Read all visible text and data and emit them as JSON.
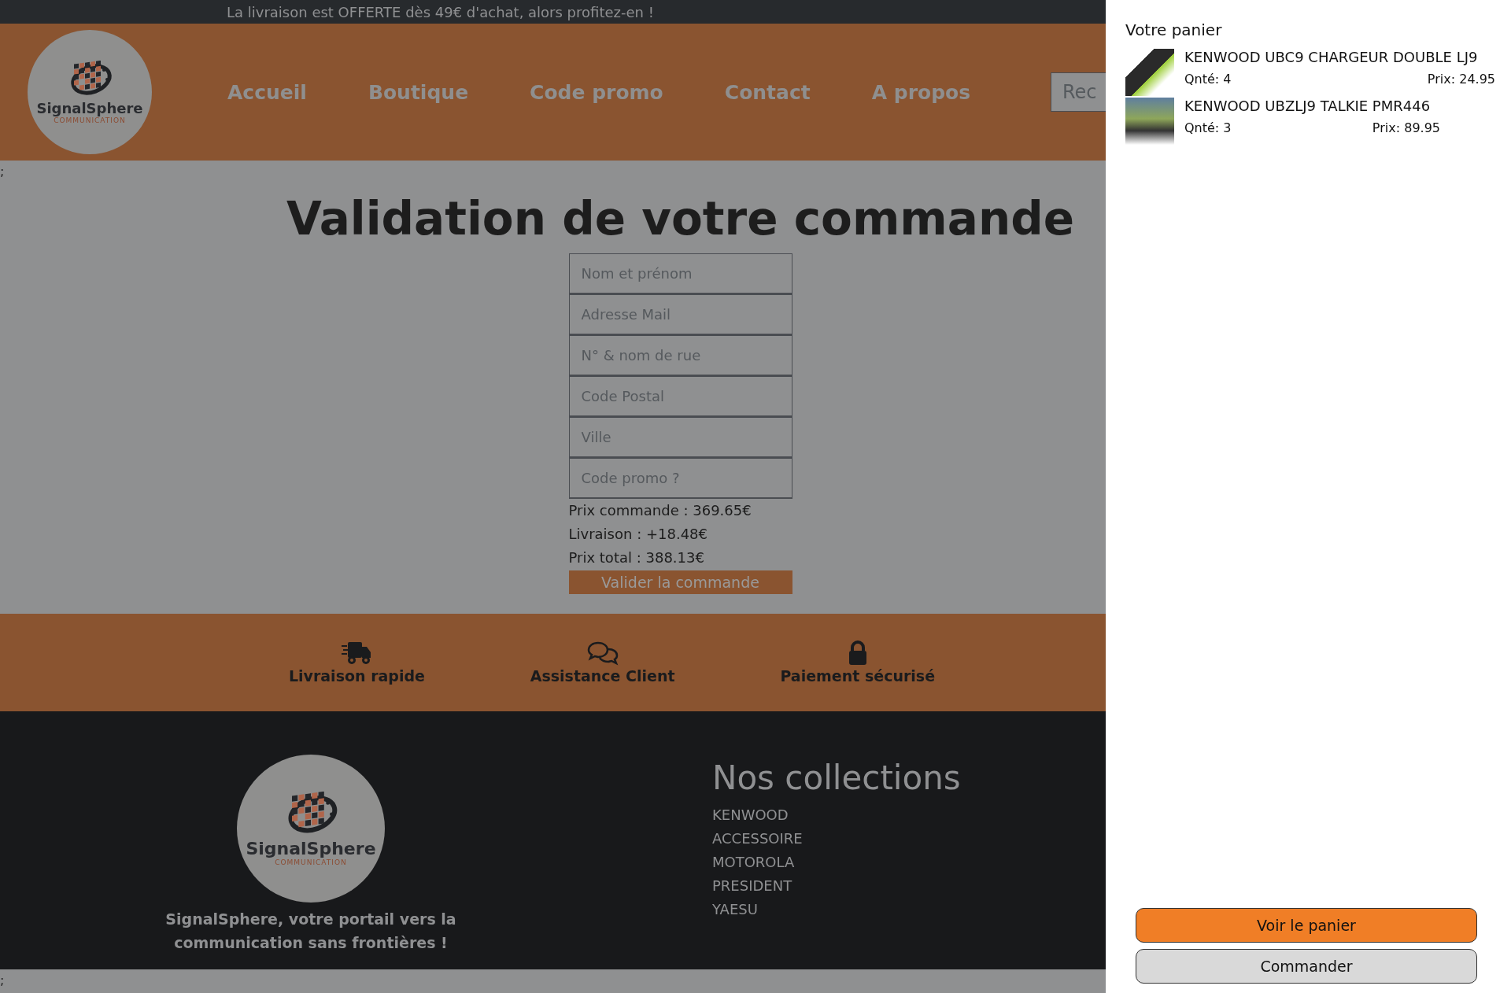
{
  "announcement": "La livraison est OFFERTE dès 49€ d'achat, alors profitez-en !",
  "header": {
    "logo": {
      "name": "SignalSphere",
      "tagline": "COMMUNICATION"
    },
    "nav": [
      {
        "label": "Accueil"
      },
      {
        "label": "Boutique"
      },
      {
        "label": "Code promo"
      },
      {
        "label": "Contact"
      },
      {
        "label": "A propos"
      }
    ],
    "search": {
      "placeholder": "Rec"
    }
  },
  "stray_text_top": ";",
  "checkout": {
    "title": "Validation de votre commande",
    "fields": [
      {
        "placeholder": "Nom et prénom"
      },
      {
        "placeholder": "Adresse Mail"
      },
      {
        "placeholder": "N° & nom de rue"
      },
      {
        "placeholder": "Code Postal"
      },
      {
        "placeholder": "Ville"
      },
      {
        "placeholder": "Code promo ?"
      }
    ],
    "summary": [
      "Prix commande : 369.65€",
      "Livraison : +18.48€",
      "Prix total : 388.13€"
    ],
    "submit": "Valider la commande"
  },
  "features": [
    {
      "kind": "truck",
      "label": "Livraison rapide"
    },
    {
      "kind": "chat",
      "label": "Assistance Client"
    },
    {
      "kind": "lock",
      "label": "Paiement sécurisé"
    }
  ],
  "footer": {
    "logo": {
      "name": "SignalSphere",
      "tagline": "COMMUNICATION"
    },
    "slogan": "SignalSphere, votre portail vers la communication sans frontières !",
    "collections_title": "Nos collections",
    "collections": [
      "KENWOOD",
      "ACCESSOIRE",
      "MOTOROLA",
      "PRESIDENT",
      "YAESU"
    ]
  },
  "stray_text_bottom": ";",
  "cart": {
    "title": "Votre panier",
    "items": [
      {
        "name": "KENWOOD UBC9 CHARGEUR DOUBLE LJ9",
        "qty": "Qnté: 4",
        "price": "Prix: 24.95"
      },
      {
        "name": "KENWOOD UBZLJ9 TALKIE PMR446",
        "qty": "Qnté: 3",
        "price": "Prix: 89.95"
      }
    ],
    "buttons": [
      {
        "kind": "primary",
        "label": "Voir le panier"
      },
      {
        "kind": "secondary",
        "label": "Commander"
      }
    ]
  }
}
